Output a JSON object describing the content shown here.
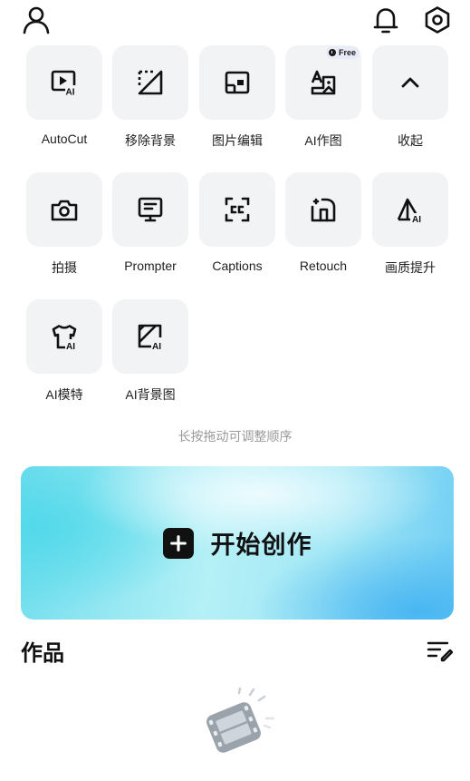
{
  "header": {
    "profile_icon": "person-icon",
    "notification_icon": "bell-icon",
    "settings_icon": "hexagon-gear-icon"
  },
  "tools": [
    {
      "label": "AutoCut",
      "icon": "play-ai-icon"
    },
    {
      "label": "移除背景",
      "icon": "remove-background-icon"
    },
    {
      "label": "图片编辑",
      "icon": "image-edit-icon"
    },
    {
      "label": "AI作图",
      "icon": "ai-drawing-icon",
      "badge": "Free"
    },
    {
      "label": "收起",
      "icon": "chevron-up-icon"
    },
    {
      "label": "拍摄",
      "icon": "camera-icon"
    },
    {
      "label": "Prompter",
      "icon": "teleprompter-icon"
    },
    {
      "label": "Captions",
      "icon": "captions-icon"
    },
    {
      "label": "Retouch",
      "icon": "retouch-icon"
    },
    {
      "label": "画质提升",
      "icon": "quality-ai-icon"
    },
    {
      "label": "AI模特",
      "icon": "ai-model-shirt-icon"
    },
    {
      "label": "AI背景图",
      "icon": "ai-background-icon"
    }
  ],
  "hint": "长按拖动可调整顺序",
  "create": {
    "label": "开始创作",
    "icon": "plus-icon"
  },
  "works": {
    "title": "作品",
    "menu_icon": "list-edit-icon",
    "empty_icon": "film-reel-icon"
  },
  "colors": {
    "card_cyan": "#6fdded",
    "card_blue": "#49b6f2",
    "tile_bg": "#f1f3f5",
    "hint": "#9a9a9a"
  }
}
